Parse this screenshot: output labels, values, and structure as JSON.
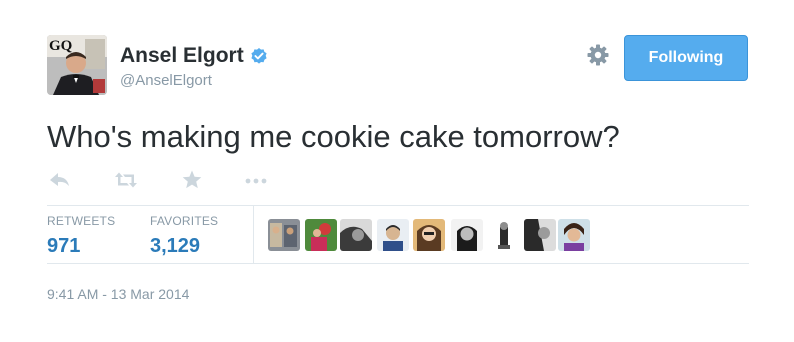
{
  "author": {
    "name": "Ansel Elgort",
    "handle": "@AnselElgort",
    "avatar_text": "GQ"
  },
  "header": {
    "follow_label": "Following"
  },
  "tweet": {
    "text": "Who's making me cookie cake tomorrow?",
    "timestamp": "9:41 AM - 13 Mar 2014"
  },
  "actions": [
    "reply-icon",
    "retweet-icon",
    "favorite-icon",
    "more-icon"
  ],
  "stats": {
    "retweets_label": "RETWEETS",
    "retweets_value": "971",
    "favorites_label": "FAVORITES",
    "favorites_value": "3,129"
  },
  "favoriters_count_shown": 9,
  "colors": {
    "follow_button": "#55acee",
    "stat_value": "#2b7bb9",
    "muted": "#8899a6",
    "verified": "#55acee"
  }
}
